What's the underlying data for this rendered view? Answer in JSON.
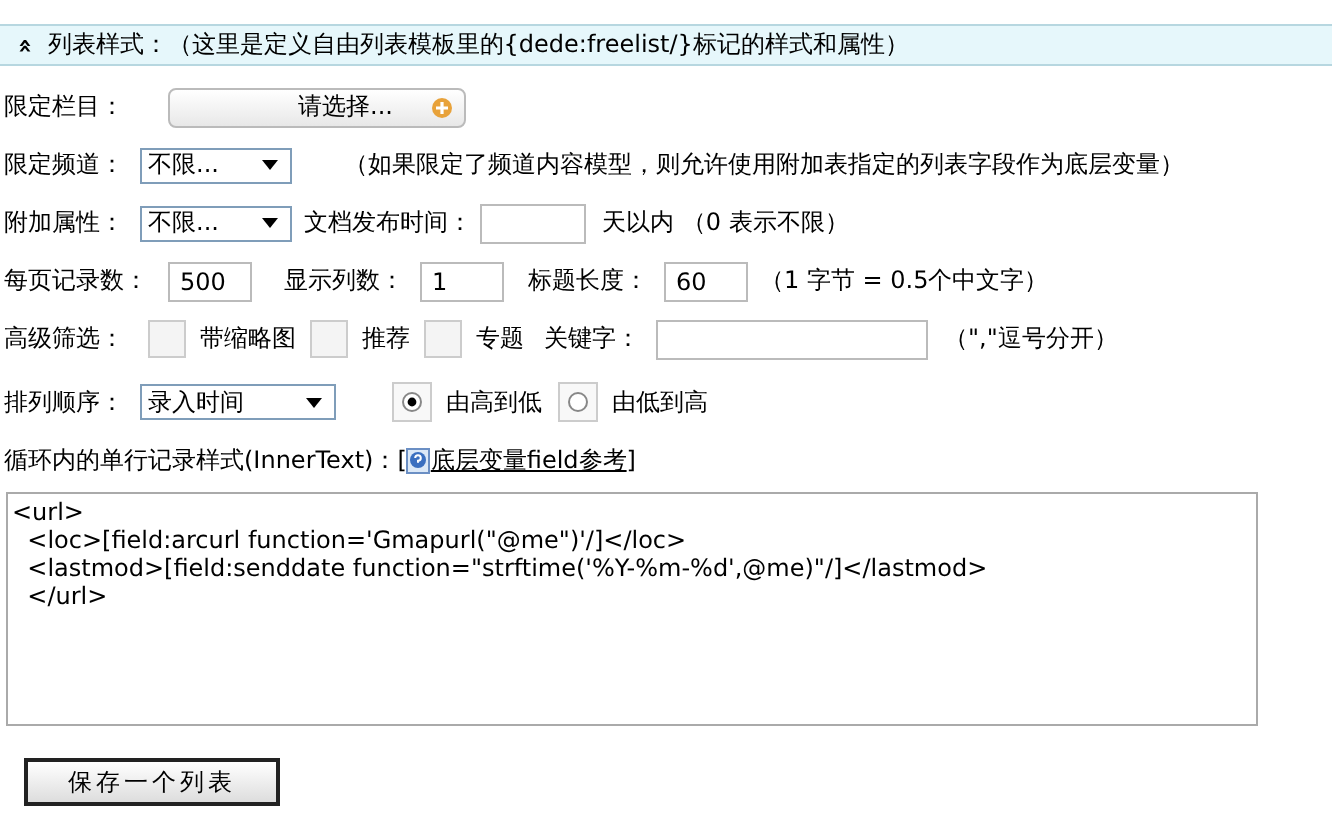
{
  "section_header": {
    "toggle": "»",
    "title": "列表样式：（这里是定义自由列表模板里的{dede:freelist/}标记的样式和属性）"
  },
  "category": {
    "label": "限定栏目：",
    "button": "请选择..."
  },
  "channel": {
    "label": "限定频道：",
    "value": "不限...",
    "note": "（如果限定了频道内容模型，则允许使用附加表指定的列表字段作为底层变量）"
  },
  "attribute": {
    "label": "附加属性：",
    "value": "不限...",
    "time_label": "文档发布时间：",
    "time_suffix": "天以内 （0 表示不限）"
  },
  "counts": {
    "per_page_label": "每页记录数：",
    "per_page": "500",
    "columns_label": "显示列数：",
    "columns": "1",
    "title_len_label": "标题长度：",
    "title_len": "60",
    "note": "（1 字节 = 0.5个中文字）"
  },
  "filter": {
    "label": "高级筛选：",
    "options": [
      {
        "label": "带缩略图",
        "checked": false
      },
      {
        "label": "推荐",
        "checked": false
      },
      {
        "label": "专题",
        "checked": false
      }
    ],
    "keyword_label": "关键字：",
    "note": "（\",\"逗号分开）"
  },
  "order": {
    "label": "排列顺序：",
    "value": "录入时间",
    "directions": [
      {
        "label": "由高到低",
        "selected": true
      },
      {
        "label": "由低到高",
        "selected": false
      }
    ]
  },
  "inner_text": {
    "label": "循环内的单行记录样式(InnerText)：[",
    "link": "底层变量field参考",
    "close": "]",
    "value": "<url>\n  <loc>[field:arcurl function='Gmapurl(\"@me\")'/]</loc>\n  <lastmod>[field:senddate function=\"strftime('%Y-%m-%d',@me)\"/]</lastmod>\n  </url>"
  },
  "save_button": "保存一个列表"
}
